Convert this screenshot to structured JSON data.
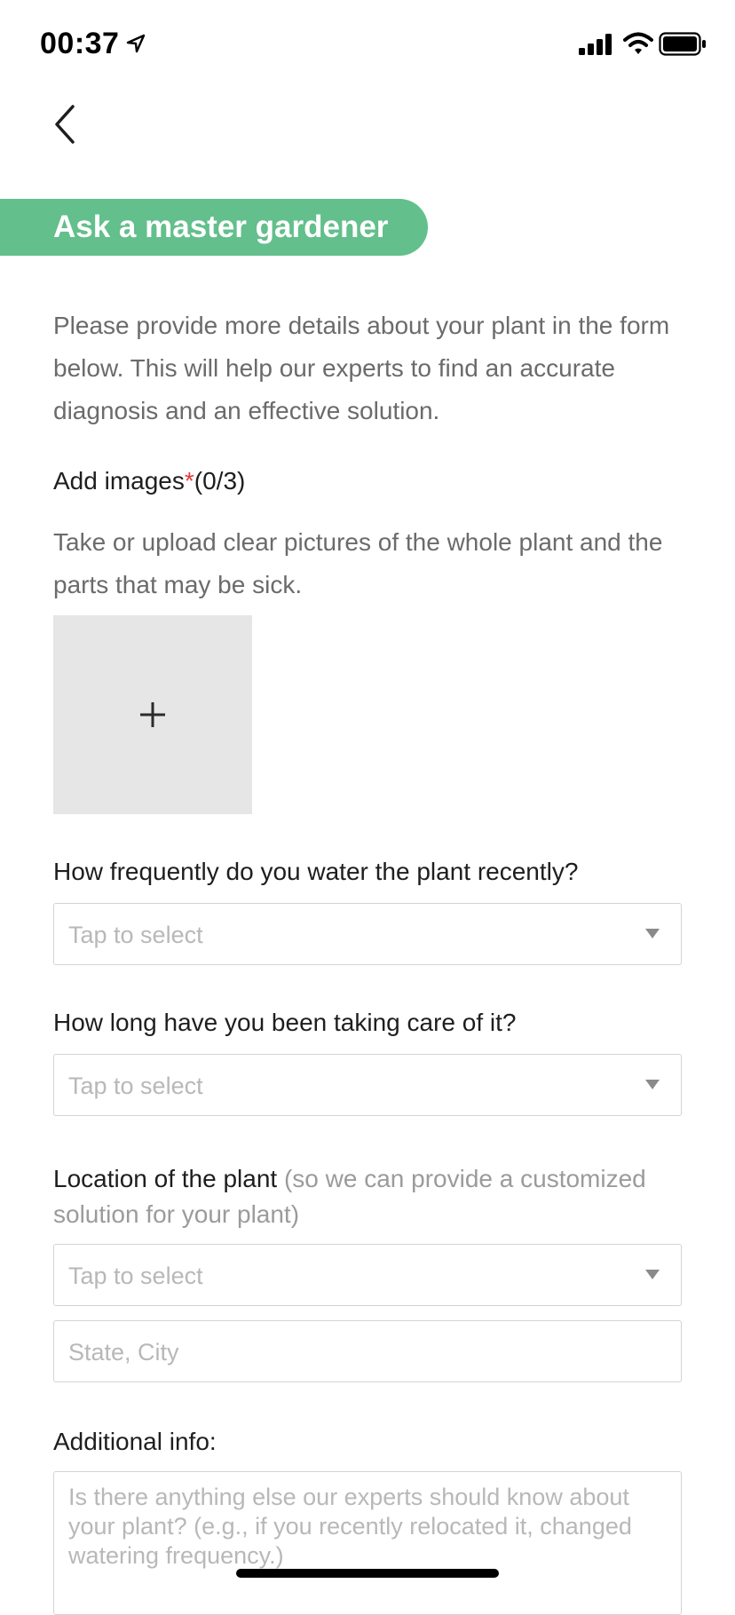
{
  "status_bar": {
    "time": "00:37",
    "icons": [
      "location-arrow-icon",
      "signal-icon",
      "wifi-icon",
      "battery-icon"
    ]
  },
  "nav": {
    "back_icon": "chevron-left-icon"
  },
  "header": {
    "title": "Ask a master gardener"
  },
  "intro": "Please provide more details about your plant in the form below. This will help our experts to find an accurate diagnosis and an effective solution.",
  "images": {
    "label": "Add images",
    "required_mark": "*",
    "count": "(0/3)",
    "hint": "Take or upload clear pictures of the whole plant and the parts that may be sick.",
    "add_icon": "plus-icon"
  },
  "watering": {
    "label": "How frequently do you water the plant recently?",
    "placeholder": "Tap to select"
  },
  "care_duration": {
    "label": "How long have you been taking care of it?",
    "placeholder": "Tap to select"
  },
  "location": {
    "label": "Location of the plant",
    "hint": "(so we can provide a customized solution for your plant)",
    "placeholder": "Tap to select",
    "city_placeholder": "State, City"
  },
  "additional": {
    "label": "Additional info:",
    "placeholder": "Is there anything else our experts should know about your plant? (e.g., if you recently relocated it, changed watering frequency.)"
  },
  "colors": {
    "accent": "#63bf8c",
    "required": "#e53935",
    "placeholder": "#b8b8b8"
  }
}
